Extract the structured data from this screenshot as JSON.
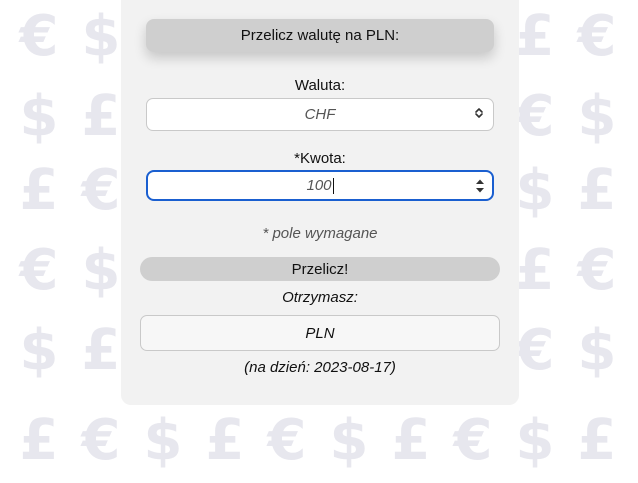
{
  "form": {
    "title": "Przelicz walutę na PLN:",
    "currency_label": "Waluta:",
    "currency_selected": "CHF",
    "amount_label": "*Kwota:",
    "amount_value": "100",
    "required_note": "* pole wymagane",
    "convert_button": "Przelicz!",
    "receive_label": "Otrzymasz:",
    "result_value": "PLN",
    "date_note": "(na dzień: 2023-08-17)"
  },
  "background": {
    "symbols": [
      "€",
      "$",
      "£"
    ],
    "symbol_color": "#e7e7ee"
  },
  "colors": {
    "card_background": "#f2f2f2",
    "focus_border": "#1a5fd0",
    "button_background": "#cfcfcf"
  },
  "icons": {
    "select": "chevron-up-down-icon",
    "spinner": "number-spinner-icon"
  }
}
